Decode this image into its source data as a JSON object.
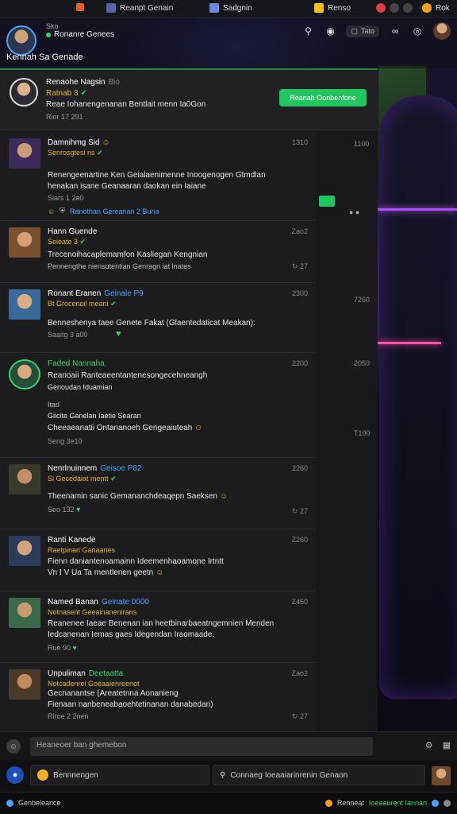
{
  "colors": {
    "accent_green": "#22c55e",
    "tag_gold": "#e7b23a",
    "link_blue": "#4aa3ff",
    "neon_purple": "#b24bff"
  },
  "topbar": {
    "tab1": "Reanpt Genain",
    "tab2": "Sadgnin",
    "tab3": "Renso",
    "tab4": "Rok"
  },
  "header": {
    "sub_label": "Sko",
    "status_text": "Ronanre Genees",
    "channel_name": "Kennah Sa Genade",
    "tag_chip": "Tato"
  },
  "pinned": {
    "name": "Renaohe Nagsin",
    "handle": "Bio",
    "tag": "Ratnab 3",
    "text": "Reae Iohanengenanan Bentlait menn Ia0Gon",
    "time": "Rior 17 291",
    "button_label": "Reanah Oonbenfone"
  },
  "side": {
    "time1": "1100",
    "time2": "7260",
    "time3": "2050",
    "time4": "T100"
  },
  "posts": [
    {
      "name": "Damnihmg Sid",
      "sub": "Senrosgtesi ns",
      "time": "1310",
      "line1": "Renengeenartine Ken Geialaenimenne Inoogenogen Gtmdlan",
      "line2": "henakan isane Geanaaran daokan ein Iaiane",
      "meta": "Siars 1 2a0",
      "tags": "Ranothan Gereanan 2 Buna"
    },
    {
      "name": "Hann Guende",
      "sub": "Seieate 3",
      "time": "Zao2",
      "line1": "Trecenoihacaplemamfon Kasliegan Kengnian",
      "line2": "Pennengthe niensutentian Genragn iat lnates",
      "react": "27"
    },
    {
      "name": "Ronant Eranen",
      "badge": "Geinale P9",
      "sub": "Bt Grocenoil meani",
      "time": "2300",
      "line1": "Benneshenya taee Genete Fakat (Glaentedaticat Meakan):",
      "line2": "Saaitg 3 a00"
    },
    {
      "name": "Faded Nannaha",
      "time": "2200",
      "line1": "Reanoaii Ranteaeentantenesongecehneangh",
      "line2": "Genoudan Iduamian",
      "line3": "Itad",
      "line4": "Giicite Ganelan Iaetie Searan",
      "line5": "Cheeaeanatii Ontananoeh Gengeaiuteah",
      "meta": "Seng 3e10"
    },
    {
      "name": "Nenrlnuinnem",
      "badge": "Geisoe P82",
      "sub": "Si Gecedaiat mentt",
      "time": "2260",
      "line1": "Theenamin sanic Gemananchdeaqepn Saeksen",
      "meta": "Seo 132",
      "react": "27"
    },
    {
      "name": "Ranti Kanede",
      "sub": "Raetpinari Ganaanes",
      "time": "Z260",
      "line1": "Fienn daniantenoamainn Ideemenhaoamone Irtntt",
      "line2": "Vn I V Ua Ta mentlenen geetn"
    },
    {
      "name": "Named Banan",
      "badge": "Geinate 0000",
      "sub": "Notnasent Geeainanenirans",
      "time": "Z450",
      "line1": "Reanenee Iaeae Benenan  ian heetbinarbaeatngemnien Menden",
      "line2": "Iedcanenan Iemas gaes Idegendan Iraomaade.",
      "meta": "Rue 90"
    },
    {
      "name": "Unpuliman",
      "badge": "Deetaatta",
      "sub": "Notcadenrei Goeaaienreenot",
      "time": "Zao2",
      "line1": "Gecnanantse (Areatetnna Aonanieng",
      "line2": "Fienaan nanbeneabaoehtetinanan danabedan)",
      "meta": "Riroe 2 2nen",
      "react": "27"
    }
  ],
  "compose": {
    "placeholder": "Heaneoer ban ghemebon"
  },
  "search": {
    "left_label": "Bennnengen",
    "right_label": "Connaeg Ioeaaiarinrenin Genaon"
  },
  "statusbar": {
    "left": "Genbeleance",
    "right_prefix": "Renneat",
    "right_link": "Ioeaaurent Iannan"
  }
}
